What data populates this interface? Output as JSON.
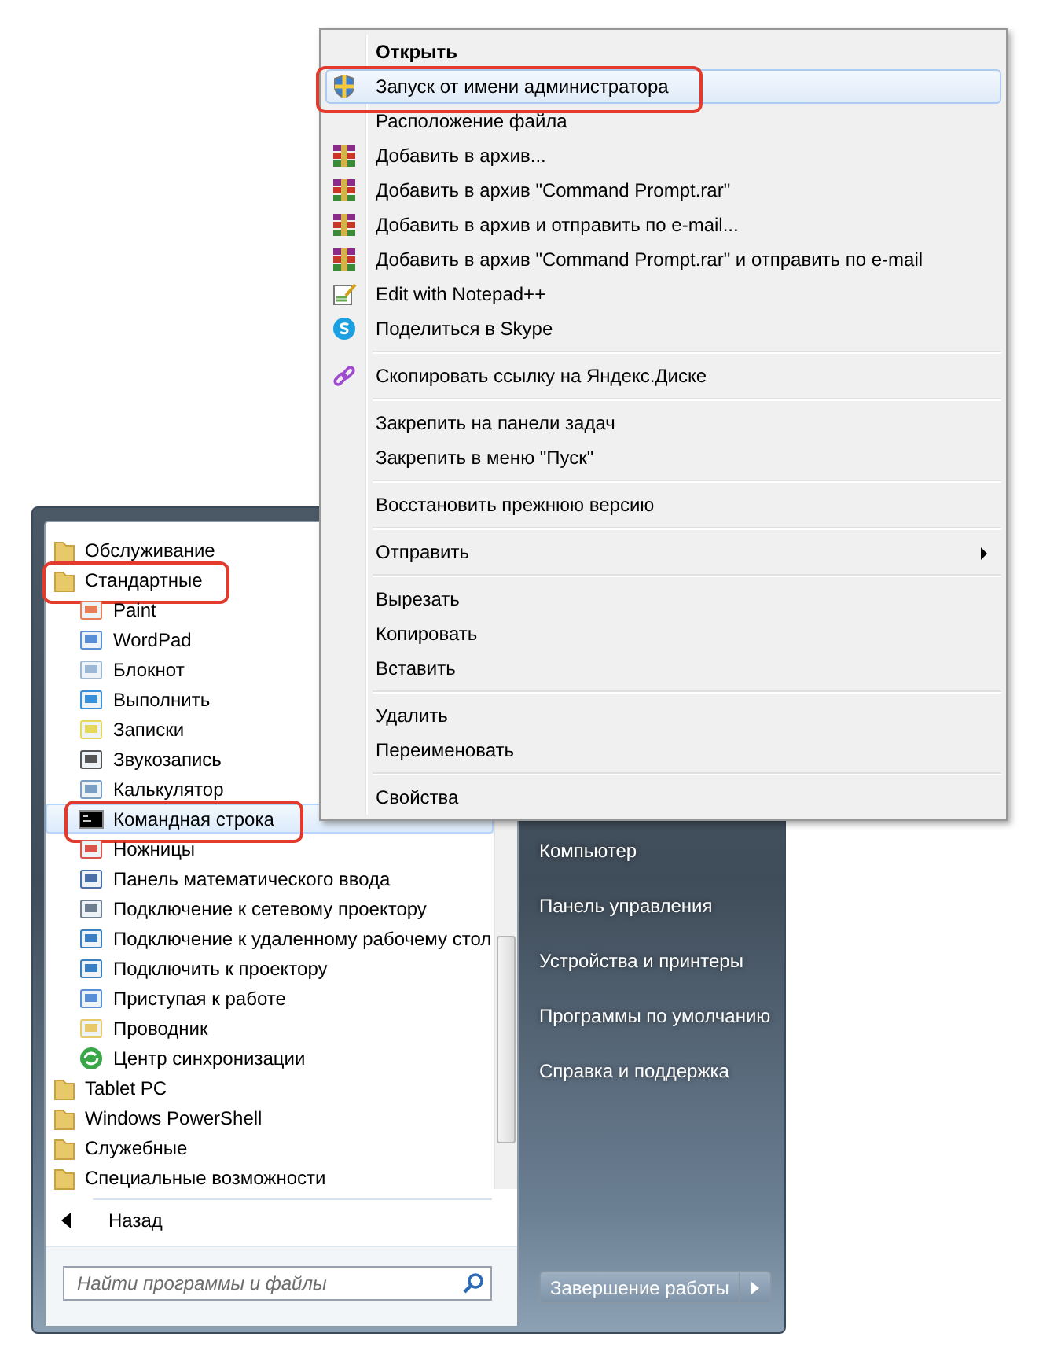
{
  "start_menu": {
    "programs": [
      {
        "label": "Обслуживание",
        "kind": "folder",
        "selected": false,
        "annotated": false
      },
      {
        "label": "Стандартные",
        "kind": "folder",
        "selected": false,
        "annotated": true
      },
      {
        "label": "Paint",
        "kind": "paint",
        "selected": false,
        "annotated": false
      },
      {
        "label": "WordPad",
        "kind": "doc",
        "selected": false,
        "annotated": false
      },
      {
        "label": "Блокнот",
        "kind": "notepad",
        "selected": false,
        "annotated": false
      },
      {
        "label": "Выполнить",
        "kind": "run",
        "selected": false,
        "annotated": false
      },
      {
        "label": "Записки",
        "kind": "notes",
        "selected": false,
        "annotated": false
      },
      {
        "label": "Звукозапись",
        "kind": "mic",
        "selected": false,
        "annotated": false
      },
      {
        "label": "Калькулятор",
        "kind": "calc",
        "selected": false,
        "annotated": false
      },
      {
        "label": "Командная строка",
        "kind": "console",
        "selected": true,
        "annotated": true
      },
      {
        "label": "Ножницы",
        "kind": "scissors",
        "selected": false,
        "annotated": false
      },
      {
        "label": "Панель математического ввода",
        "kind": "pen",
        "selected": false,
        "annotated": false
      },
      {
        "label": "Подключение к сетевому проектору",
        "kind": "projector",
        "selected": false,
        "annotated": false
      },
      {
        "label": "Подключение к удаленному рабочему стол",
        "kind": "monitor",
        "selected": false,
        "annotated": false
      },
      {
        "label": "Подключить к проектору",
        "kind": "monitor",
        "selected": false,
        "annotated": false
      },
      {
        "label": "Приступая к работе",
        "kind": "doc",
        "selected": false,
        "annotated": false
      },
      {
        "label": "Проводник",
        "kind": "explorer",
        "selected": false,
        "annotated": false
      },
      {
        "label": "Центр синхронизации",
        "kind": "sync",
        "selected": false,
        "annotated": false
      },
      {
        "label": "Tablet PC",
        "kind": "folder",
        "selected": false,
        "annotated": false
      },
      {
        "label": "Windows PowerShell",
        "kind": "folder",
        "selected": false,
        "annotated": false
      },
      {
        "label": "Служебные",
        "kind": "folder",
        "selected": false,
        "annotated": false
      },
      {
        "label": "Специальные возможности",
        "kind": "folder",
        "selected": false,
        "annotated": false
      }
    ],
    "back": "Назад",
    "search": {
      "placeholder": "Найти программы и файлы"
    },
    "right_items": [
      "Компьютер",
      "Панель управления",
      "Устройства и принтеры",
      "Программы по умолчанию",
      "Справка и поддержка"
    ],
    "shutdown": "Завершение работы"
  },
  "context_menu": {
    "groups": [
      [
        {
          "label": "Открыть",
          "kind": "none",
          "bold": true,
          "selected": false,
          "annotated": false,
          "submenu": false
        },
        {
          "label": "Запуск от имени администратора",
          "kind": "shield",
          "bold": false,
          "selected": true,
          "annotated": true,
          "submenu": false
        },
        {
          "label": "Расположение файла",
          "kind": "none",
          "bold": false,
          "selected": false,
          "annotated": false,
          "submenu": false
        },
        {
          "label": "Добавить в архив...",
          "kind": "archive",
          "bold": false,
          "selected": false,
          "annotated": false,
          "submenu": false
        },
        {
          "label": "Добавить в архив \"Command Prompt.rar\"",
          "kind": "archive",
          "bold": false,
          "selected": false,
          "annotated": false,
          "submenu": false
        },
        {
          "label": "Добавить в архив и отправить по e-mail...",
          "kind": "archive",
          "bold": false,
          "selected": false,
          "annotated": false,
          "submenu": false
        },
        {
          "label": "Добавить в архив \"Command Prompt.rar\" и отправить по e-mail",
          "kind": "archive",
          "bold": false,
          "selected": false,
          "annotated": false,
          "submenu": false
        },
        {
          "label": "Edit with Notepad++",
          "kind": "notepad",
          "bold": false,
          "selected": false,
          "annotated": false,
          "submenu": false
        },
        {
          "label": "Поделиться в Skype",
          "kind": "skype",
          "bold": false,
          "selected": false,
          "annotated": false,
          "submenu": false
        }
      ],
      [
        {
          "label": "Скопировать ссылку на Яндекс.Диске",
          "kind": "link",
          "bold": false,
          "selected": false,
          "annotated": false,
          "submenu": false
        }
      ],
      [
        {
          "label": "Закрепить на панели задач",
          "kind": "none",
          "bold": false,
          "selected": false,
          "annotated": false,
          "submenu": false
        },
        {
          "label": "Закрепить в меню \"Пуск\"",
          "kind": "none",
          "bold": false,
          "selected": false,
          "annotated": false,
          "submenu": false
        }
      ],
      [
        {
          "label": "Восстановить прежнюю версию",
          "kind": "none",
          "bold": false,
          "selected": false,
          "annotated": false,
          "submenu": false
        }
      ],
      [
        {
          "label": "Отправить",
          "kind": "none",
          "bold": false,
          "selected": false,
          "annotated": false,
          "submenu": true
        }
      ],
      [
        {
          "label": "Вырезать",
          "kind": "none",
          "bold": false,
          "selected": false,
          "annotated": false,
          "submenu": false
        },
        {
          "label": "Копировать",
          "kind": "none",
          "bold": false,
          "selected": false,
          "annotated": false,
          "submenu": false
        },
        {
          "label": "Вставить",
          "kind": "none",
          "bold": false,
          "selected": false,
          "annotated": false,
          "submenu": false
        }
      ],
      [
        {
          "label": "Удалить",
          "kind": "none",
          "bold": false,
          "selected": false,
          "annotated": false,
          "submenu": false
        },
        {
          "label": "Переименовать",
          "kind": "none",
          "bold": false,
          "selected": false,
          "annotated": false,
          "submenu": false
        }
      ],
      [
        {
          "label": "Свойства",
          "kind": "none",
          "bold": false,
          "selected": false,
          "annotated": false,
          "submenu": false
        }
      ]
    ]
  }
}
